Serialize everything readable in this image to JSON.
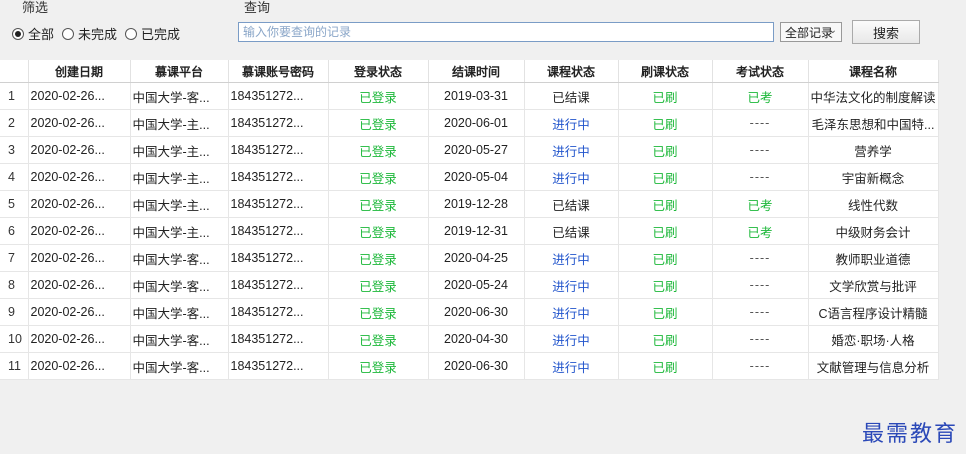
{
  "filter": {
    "title": "筛选",
    "options": [
      "全部",
      "未完成",
      "已完成"
    ],
    "selected_index": 0
  },
  "query": {
    "title": "查询",
    "placeholder": "输入你要查询的记录",
    "scope_selected": "全部记录",
    "search_label": "搜索"
  },
  "table": {
    "columns": [
      "",
      "创建日期",
      "慕课平台",
      "慕课账号密码",
      "登录状态",
      "结课时间",
      "课程状态",
      "刷课状态",
      "考试状态",
      "课程名称"
    ],
    "rows": [
      [
        "1",
        "2020-02-26...",
        "中国大学-客...",
        "184351272...",
        "已登录",
        "2019-03-31",
        "已结课",
        "已刷",
        "已考",
        "中华法文化的制度解读"
      ],
      [
        "2",
        "2020-02-26...",
        "中国大学-主...",
        "184351272...",
        "已登录",
        "2020-06-01",
        "进行中",
        "已刷",
        "----",
        "毛泽东思想和中国特..."
      ],
      [
        "3",
        "2020-02-26...",
        "中国大学-主...",
        "184351272...",
        "已登录",
        "2020-05-27",
        "进行中",
        "已刷",
        "----",
        "营养学"
      ],
      [
        "4",
        "2020-02-26...",
        "中国大学-主...",
        "184351272...",
        "已登录",
        "2020-05-04",
        "进行中",
        "已刷",
        "----",
        "宇宙新概念"
      ],
      [
        "5",
        "2020-02-26...",
        "中国大学-主...",
        "184351272...",
        "已登录",
        "2019-12-28",
        "已结课",
        "已刷",
        "已考",
        "线性代数"
      ],
      [
        "6",
        "2020-02-26...",
        "中国大学-主...",
        "184351272...",
        "已登录",
        "2019-12-31",
        "已结课",
        "已刷",
        "已考",
        "中级财务会计"
      ],
      [
        "7",
        "2020-02-26...",
        "中国大学-客...",
        "184351272...",
        "已登录",
        "2020-04-25",
        "进行中",
        "已刷",
        "----",
        "教师职业道德"
      ],
      [
        "8",
        "2020-02-26...",
        "中国大学-客...",
        "184351272...",
        "已登录",
        "2020-05-24",
        "进行中",
        "已刷",
        "----",
        "文学欣赏与批评"
      ],
      [
        "9",
        "2020-02-26...",
        "中国大学-客...",
        "184351272...",
        "已登录",
        "2020-06-30",
        "进行中",
        "已刷",
        "----",
        "C语言程序设计精髓"
      ],
      [
        "10",
        "2020-02-26...",
        "中国大学-客...",
        "184351272...",
        "已登录",
        "2020-04-30",
        "进行中",
        "已刷",
        "----",
        "婚恋·职场·人格"
      ],
      [
        "11",
        "2020-02-26...",
        "中国大学-客...",
        "184351272...",
        "已登录",
        "2020-06-30",
        "进行中",
        "已刷",
        "----",
        "文献管理与信息分析"
      ]
    ]
  },
  "watermark": "最需教育",
  "colors": {
    "green": "#1db83a",
    "blue": "#2255cc",
    "watermark": "#2b49b8"
  }
}
